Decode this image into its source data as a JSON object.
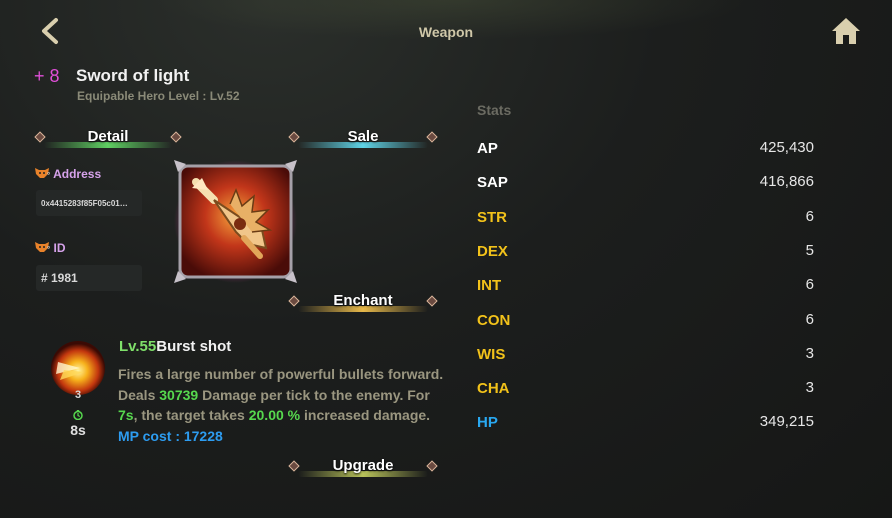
{
  "header": {
    "title": "Weapon"
  },
  "item": {
    "plus": "+ 8",
    "name": "Sword of light",
    "equip_level": "Equipable Hero Level : Lv.52",
    "address_label": "Address",
    "address": "0x4415283f85F05c01…",
    "id_label": "ID",
    "id": "# 1981"
  },
  "tabs": {
    "detail": "Detail",
    "sale": "Sale",
    "enchant": "Enchant",
    "upgrade": "Upgrade"
  },
  "skill": {
    "level": "Lv.55",
    "name": "Burst shot",
    "count": "3",
    "cooldown": "8s",
    "desc_1": "Fires a large number of powerful bullets forward. Deals ",
    "damage": "30739",
    "desc_2": " Damage per tick to the enemy. For ",
    "duration": "7s",
    "desc_3": ",  the target takes ",
    "percent": "20.00 %",
    "desc_4": " increased damage.",
    "mp_cost": "MP cost : 17228"
  },
  "stats": {
    "header": "Stats",
    "rows": [
      {
        "name": "AP",
        "value": "425,430"
      },
      {
        "name": "SAP",
        "value": "416,866"
      },
      {
        "name": "STR",
        "value": "6"
      },
      {
        "name": "DEX",
        "value": "5"
      },
      {
        "name": "INT",
        "value": "6"
      },
      {
        "name": "CON",
        "value": "6"
      },
      {
        "name": "WIS",
        "value": "3"
      },
      {
        "name": "CHA",
        "value": "3"
      },
      {
        "name": "HP",
        "value": "349,215"
      }
    ]
  },
  "icons": {
    "back": "back-arrow-icon",
    "home": "home-icon",
    "fox": "fox-wallet-icon",
    "cooldown": "cooldown-icon"
  },
  "colors": {
    "plus": "#e04fd8",
    "stat_primary": "#ffffff",
    "stat_attribute": "#f2c21a",
    "stat_hp": "#29a8f0",
    "skill_level": "#7fe06a",
    "highlight": "#56d84e",
    "mp": "#2d9cf0"
  }
}
